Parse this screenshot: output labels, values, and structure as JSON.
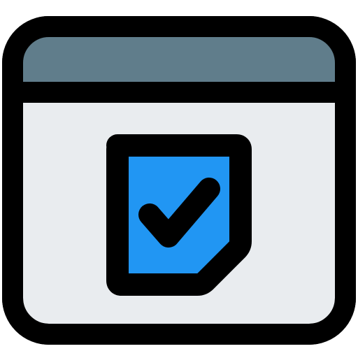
{
  "icon": {
    "name": "browser-window-checked-document-icon",
    "colors": {
      "outline": "#000000",
      "title_bar": "#607D8B",
      "window_body": "#E9ECEF",
      "document": "#2196F3",
      "background": "#FFFFFF"
    },
    "parts": [
      "window-frame",
      "title-bar",
      "document",
      "check-mark"
    ]
  }
}
